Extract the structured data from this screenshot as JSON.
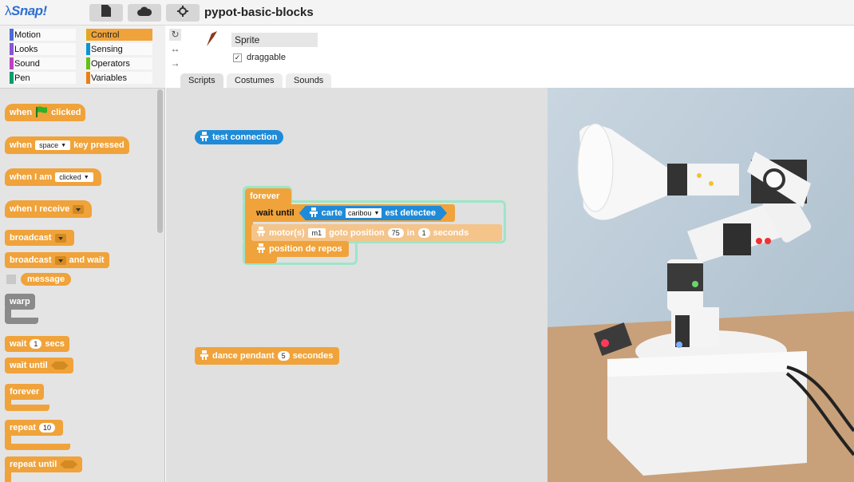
{
  "app": {
    "logo": "Snap!",
    "title": "pypot-basic-blocks"
  },
  "toolbar": {
    "file_icon": "file-icon",
    "cloud_icon": "cloud-icon",
    "settings_icon": "gear-icon"
  },
  "categories": [
    {
      "label": "Motion",
      "color": "#4a6cd4"
    },
    {
      "label": "Control",
      "color": "#e1a91a"
    },
    {
      "label": "Looks",
      "color": "#8a55d7"
    },
    {
      "label": "Sensing",
      "color": "#0994d6"
    },
    {
      "label": "Sound",
      "color": "#bb42c3"
    },
    {
      "label": "Operators",
      "color": "#62c213"
    },
    {
      "label": "Pen",
      "color": "#0e9a6c"
    },
    {
      "label": "Variables",
      "color": "#ee7d16"
    }
  ],
  "palette": {
    "when": "when",
    "clicked": "clicked",
    "key_pressed": "key pressed",
    "space": "space",
    "when_i_am": "when I am",
    "clicked_opt": "clicked",
    "when_i_receive": "when I receive",
    "broadcast": "broadcast",
    "broadcast_wait_1": "broadcast",
    "and_wait": "and wait",
    "message": "message",
    "warp": "warp",
    "wait": "wait",
    "wait_val": "1",
    "secs": "secs",
    "wait_until": "wait until",
    "forever": "forever",
    "repeat": "repeat",
    "repeat_val": "10",
    "repeat_until": "repeat until"
  },
  "sprite": {
    "name": "Sprite",
    "draggable_label": "draggable",
    "draggable_checked": "✓"
  },
  "tabs": [
    {
      "label": "Scripts"
    },
    {
      "label": "Costumes"
    },
    {
      "label": "Sounds"
    }
  ],
  "scripts": {
    "test_connection": "test connection",
    "forever": "forever",
    "wait_until": "wait until",
    "carte": "carte",
    "caribou": "caribou",
    "est_detectee": "est detectee",
    "motors": "motor(s)",
    "m1": "m1",
    "goto_position": "goto position",
    "pos_val": "75",
    "in": "in",
    "in_val": "1",
    "seconds": "seconds",
    "position_de_repos": "position de repos",
    "dance": "dance pendant",
    "dance_val": "5",
    "secondes": "secondes"
  }
}
